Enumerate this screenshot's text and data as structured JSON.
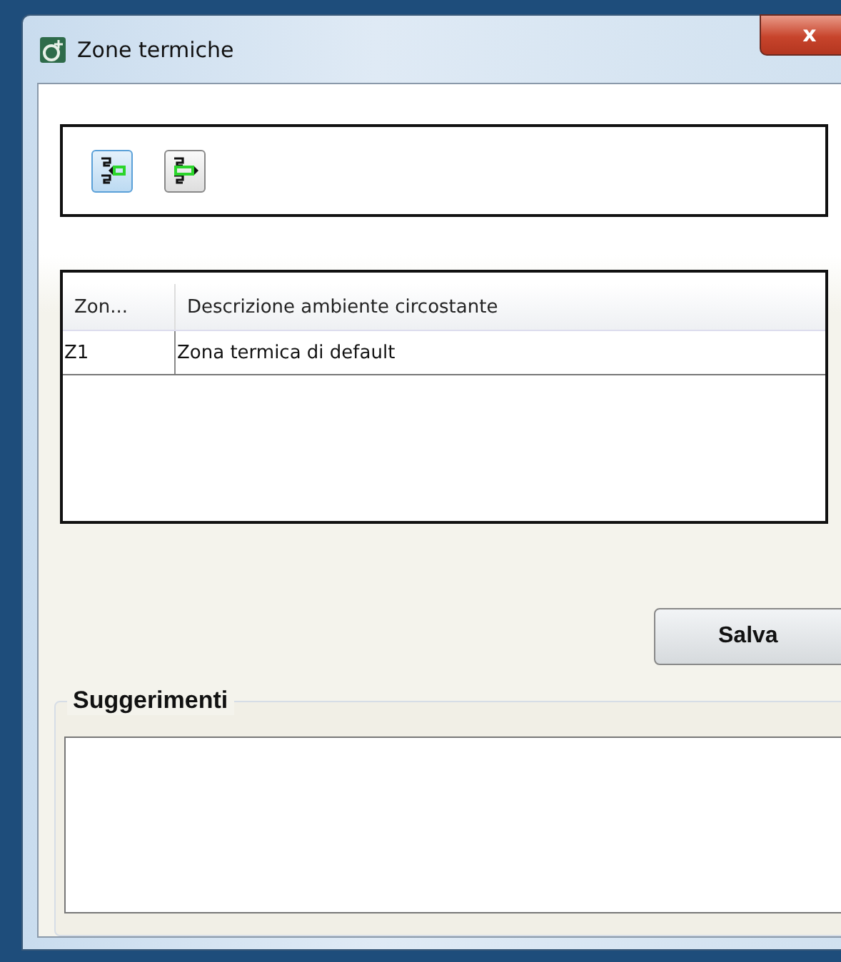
{
  "window": {
    "title": "Zone termiche",
    "close": "x"
  },
  "toolbar": {
    "buttons": [
      {
        "kind": "insert",
        "selected": true
      },
      {
        "kind": "extract",
        "selected": false
      }
    ]
  },
  "table": {
    "columns": [
      "Zon...",
      "Descrizione ambiente circostante"
    ],
    "rows": [
      [
        "Z1",
        "Zona termica di default"
      ]
    ]
  },
  "save_button": "Salva",
  "suggestions": {
    "title": "Suggerimenti"
  }
}
